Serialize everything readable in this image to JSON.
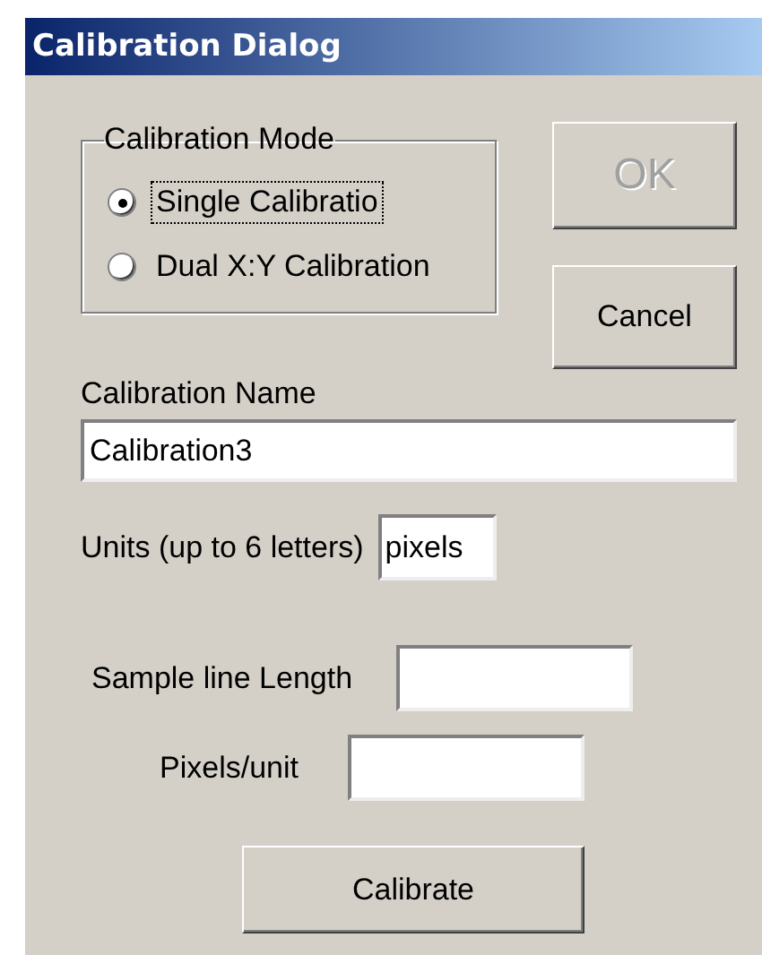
{
  "window": {
    "title": "Calibration Dialog"
  },
  "calibration_mode": {
    "label": "Calibration Mode",
    "options": [
      {
        "label": "Single Calibratio",
        "selected": true
      },
      {
        "label": "Dual X:Y Calibration",
        "selected": false
      }
    ]
  },
  "side_buttons": [
    {
      "label": "OK",
      "disabled": true
    },
    {
      "label": "Cancel",
      "disabled": false
    }
  ],
  "calibration_name": {
    "label": "Calibration Name",
    "value": "Calibration3"
  },
  "units": {
    "label": "Units (up to 6 letters)",
    "value": "pixels"
  },
  "sample_line_length": {
    "label": "Sample line Length"
  },
  "pixels_per_unit": {
    "label": "Pixels/unit"
  },
  "calibrate_button": {
    "label": "Calibrate",
    "disabled": false
  }
}
